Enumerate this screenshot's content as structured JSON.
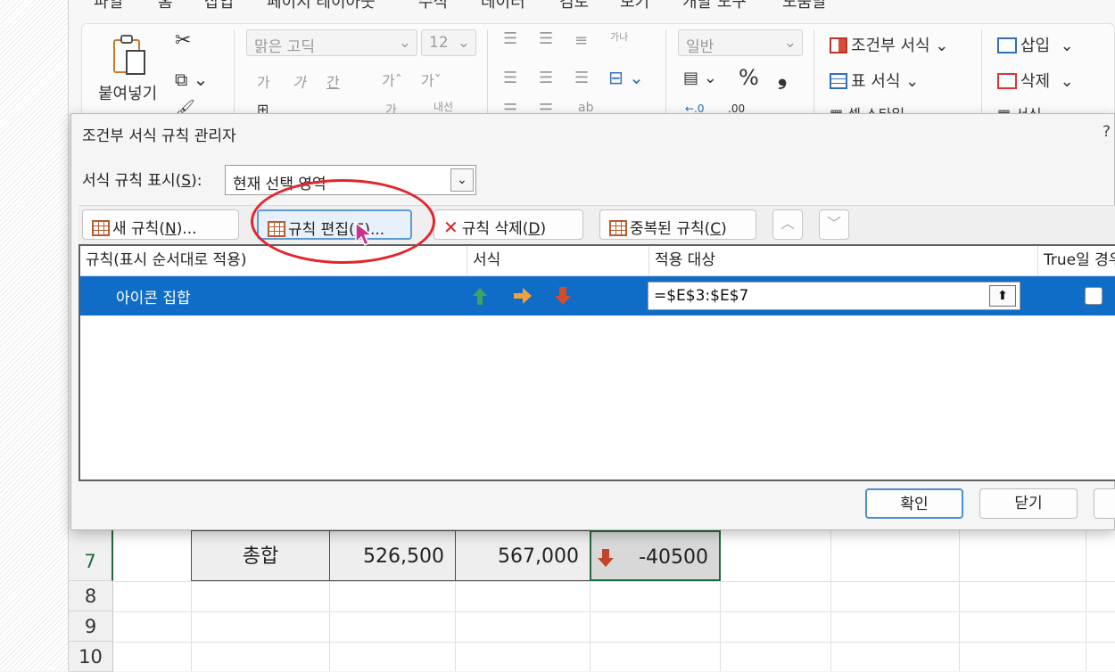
{
  "ribbon": {
    "tabs": [
      "파일",
      "홈",
      "삽입",
      "페이지 레이아웃",
      "수식",
      "데이터",
      "검토",
      "보기",
      "개발 도구",
      "도움말"
    ],
    "paste_label": "붙여넣기",
    "font_name": "맑은 고딕",
    "font_size": "12",
    "number_format": "일반",
    "percent": "%",
    "comma": "❟",
    "wrap_text": "내선",
    "conditional_format": "조건부 서식",
    "table_format": "표 서식",
    "cell_style": "셀 스타일",
    "insert": "삽입",
    "delete": "삭제",
    "format": "서식"
  },
  "dialog": {
    "title": "조건부 서식 규칙 관리자",
    "help": "?",
    "show_rules_label": "서식 규칙 표시(",
    "show_rules_key": "S",
    "show_rules_suffix": "):",
    "show_rules_value": "현재 선택 영역",
    "buttons": {
      "new_rule": "새 규칙(",
      "new_rule_key": "N",
      "new_rule_suffix": ")...",
      "edit_rule": "규칙 편집(",
      "edit_rule_key": "E",
      "edit_rule_suffix": ")...",
      "delete_rule": "규칙 삭제(",
      "delete_rule_key": "D",
      "delete_rule_suffix": ")",
      "duplicate_rule": "중복된 규칙(",
      "duplicate_rule_key": "C",
      "duplicate_rule_suffix": ")",
      "ok": "확인",
      "close": "닫기"
    },
    "columns": [
      "규칙(표시 순서대로 적용)",
      "서식",
      "적용 대상",
      "True일 경우"
    ],
    "rules": [
      {
        "name": "아이콘 집합",
        "applies_to": "=$E$3:$E$7",
        "stop_if_true": false
      }
    ]
  },
  "sheet": {
    "rows": [
      "7",
      "8",
      "9",
      "10"
    ],
    "row7": {
      "label": "총합",
      "value1": "526,500",
      "value2": "567,000",
      "diff": "-40500"
    }
  },
  "colors": {
    "accent": "#0f6cc7",
    "highlight": "#e2262c",
    "excel_green": "#1d6b3c"
  }
}
